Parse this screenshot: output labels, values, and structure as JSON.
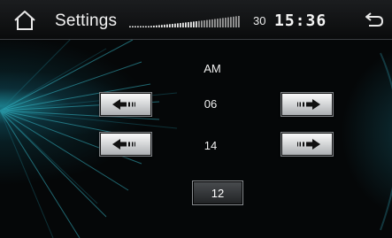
{
  "header": {
    "title": "Settings",
    "volume_value": "30",
    "clock": "15:36",
    "volume_level": 0.62
  },
  "main": {
    "period": "AM",
    "hour": "06",
    "minute": "14",
    "button_value": "12"
  },
  "icons": {
    "home": "home-icon",
    "back": "back-icon",
    "left": "arrow-left-icon",
    "right": "arrow-right-icon"
  },
  "colors": {
    "accent": "#2fb6c8",
    "button_face": "#e6e7e8",
    "topbar": "#141618"
  }
}
